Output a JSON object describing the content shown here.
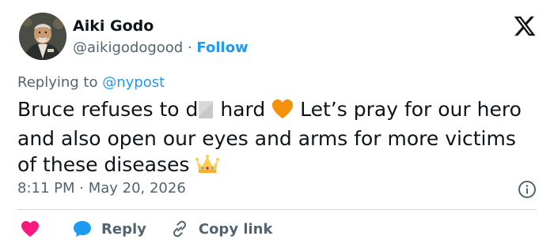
{
  "user": {
    "name": "Aiki Godo",
    "handle": "@aikigodogood",
    "separator": "·",
    "follow_label": "Follow"
  },
  "replying": {
    "prefix": "Replying to",
    "mention": "@nypost"
  },
  "tweet": {
    "text_part1": "Bruce refuses to d",
    "text_part2": " hard ",
    "text_part3": " Let’s pray for our hero and also open our eyes and arms for more victims of these diseases ",
    "emoji_heart": "orange-heart-emoji",
    "emoji_crown": "crown-emoji"
  },
  "meta": {
    "timestamp": "8:11 PM · May 20, 2026"
  },
  "actions": {
    "like_icon": "heart-icon",
    "reply_label": "Reply",
    "copy_link_label": "Copy link"
  },
  "colors": {
    "accent": "#1d9bf0",
    "like": "#f91880",
    "muted": "#536471",
    "text": "#0f1419",
    "heart_emoji": "#f4900c"
  }
}
